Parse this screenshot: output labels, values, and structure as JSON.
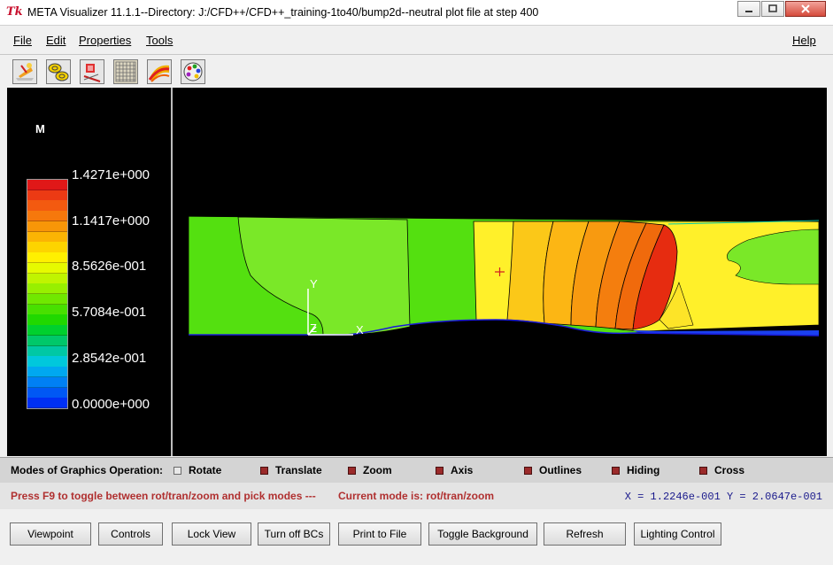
{
  "window": {
    "app_icon_text": "Tk",
    "title": "META Visualizer 11.1.1--Directory: J:/CFD++/CFD++_training-1to40/bump2d--neutral plot file at step 400"
  },
  "menu": {
    "items": [
      {
        "label": "File"
      },
      {
        "label": "Edit"
      },
      {
        "label": "Properties"
      },
      {
        "label": "Tools"
      }
    ],
    "help": "Help"
  },
  "toolbar": {
    "icons": [
      "viewpoint-tool-icon",
      "contours-tool-icon",
      "vectors-tool-icon",
      "grid-tool-icon",
      "streamlines-tool-icon",
      "color-palette-icon"
    ]
  },
  "legend": {
    "variable": "M",
    "labels": [
      "1.4271e+000",
      "1.1417e+000",
      "8.5626e-001",
      "5.7084e-001",
      "2.8542e-001",
      "0.0000e+000"
    ],
    "colors": [
      "#e01818",
      "#ec3a14",
      "#f35a10",
      "#f6780c",
      "#f89608",
      "#fbb404",
      "#fdd400",
      "#fff000",
      "#e6fa00",
      "#c0f400",
      "#98ef00",
      "#70e800",
      "#48e000",
      "#20d800",
      "#00d02e",
      "#00c86a",
      "#00c8a4",
      "#00c8dc",
      "#00a8f0",
      "#0080f4",
      "#0058f4",
      "#0030f4"
    ]
  },
  "plot": {
    "axis_x_label": "X",
    "axis_y_label": "Y",
    "axis_z_label": "Z",
    "colors": {
      "green": "#54e010",
      "light_green": "#7ae828",
      "yellow": "#fff02a",
      "yellow2": "#fde428",
      "orange_yellow": "#fbc818",
      "orange": "#f89a10",
      "orange_red": "#f06a0c",
      "red": "#e62c10",
      "pick_marker": "#d02020",
      "axis": "#ffffff"
    }
  },
  "modes": {
    "label": "Modes of Graphics Operation:",
    "options": [
      {
        "label": "Rotate",
        "checked": false
      },
      {
        "label": "Translate",
        "checked": true
      },
      {
        "label": "Zoom",
        "checked": true
      },
      {
        "label": "Axis",
        "checked": true
      },
      {
        "label": "Outlines",
        "checked": true
      },
      {
        "label": "Hiding",
        "checked": true
      },
      {
        "label": "Cross",
        "checked": true
      }
    ]
  },
  "status": {
    "hint": "Press F9 to toggle between rot/tran/zoom and pick modes ---",
    "current_mode": "Current mode is: rot/tran/zoom",
    "coords": "X = 1.2246e-001  Y = 2.0647e-001"
  },
  "buttons": [
    {
      "label": "Viewpoint"
    },
    {
      "label": "Controls"
    },
    {
      "label": "Lock View"
    },
    {
      "label": "Turn off BCs"
    },
    {
      "label": "Print to File"
    },
    {
      "label": "Toggle Background"
    },
    {
      "label": "Refresh"
    },
    {
      "label": "Lighting Control"
    }
  ]
}
